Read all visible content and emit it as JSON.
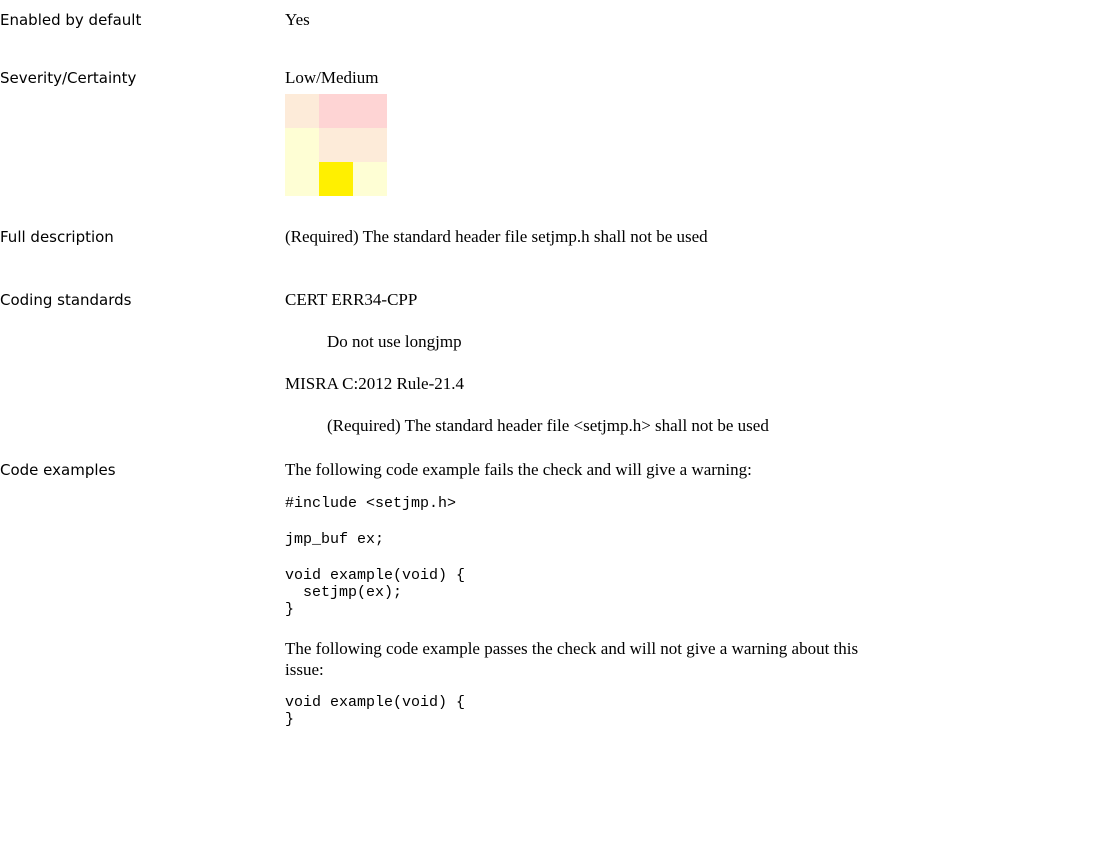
{
  "enabled": {
    "label": "Enabled by default",
    "value": "Yes"
  },
  "severity": {
    "label": "Severity/Certainty",
    "value": "Low/Medium",
    "matrix": [
      [
        "#fdebd9",
        "#fed4d4",
        "#fed4d4"
      ],
      [
        "#fefed4",
        "#fdebd9",
        "#fdebd9"
      ],
      [
        "#fefed4",
        "#fff000",
        "#fefed4"
      ]
    ]
  },
  "description": {
    "label": "Full description",
    "text": "(Required) The standard header file setjmp.h shall not be used"
  },
  "standards": {
    "label": "Coding standards",
    "items": [
      {
        "name": "CERT ERR34-CPP",
        "detail": "Do not use longjmp"
      },
      {
        "name": "MISRA C:2012 Rule-21.4",
        "detail": "(Required) The standard header file <setjmp.h> shall not be used"
      }
    ]
  },
  "examples": {
    "label": "Code examples",
    "fail_intro": "The following code example fails the check and will give a warning:",
    "fail_code": [
      "#include <setjmp.h>",
      "jmp_buf ex;",
      "void example(void) {\n  setjmp(ex);\n}"
    ],
    "pass_intro_line1": "The following code example passes the check and will not give a warning about this",
    "pass_intro_line2": "issue:",
    "pass_code": "void example(void) {\n}"
  }
}
